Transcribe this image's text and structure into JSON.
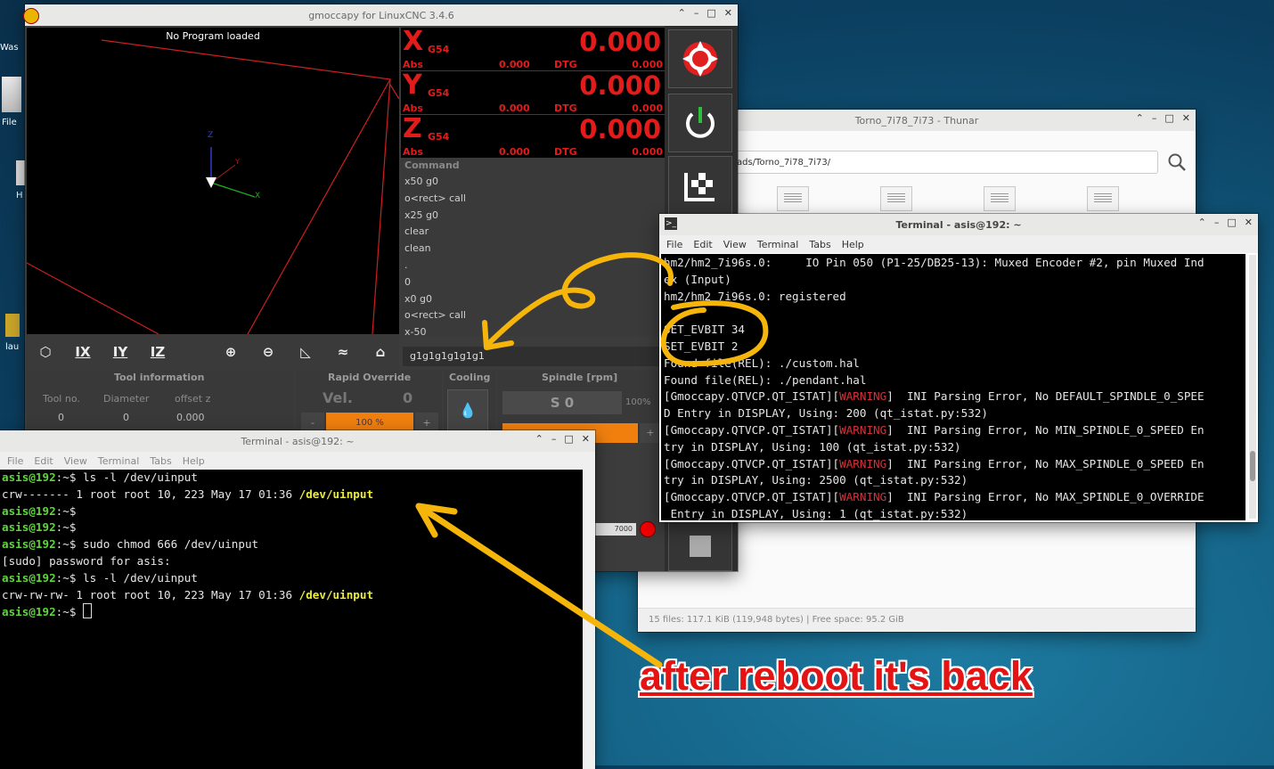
{
  "desktop": {
    "icons": [
      {
        "label": "Was"
      },
      {
        "label": "File"
      },
      {
        "label": "H"
      },
      {
        "label": "lau"
      }
    ]
  },
  "gmoccapy": {
    "title": "gmoccapy for LinuxCNC  3.4.6",
    "preview_title": "No Program loaded",
    "axes": [
      {
        "axis": "X",
        "offset": "G54",
        "value": "0.000",
        "abs_label": "Abs",
        "abs": "0.000",
        "dtg_label": "DTG",
        "dtg": "0.000"
      },
      {
        "axis": "Y",
        "offset": "G54",
        "value": "0.000",
        "abs_label": "Abs",
        "abs": "0.000",
        "dtg_label": "DTG",
        "dtg": "0.000"
      },
      {
        "axis": "Z",
        "offset": "G54",
        "value": "0.000",
        "abs_label": "Abs",
        "abs": "0.000",
        "dtg_label": "DTG",
        "dtg": "0.000"
      }
    ],
    "command_header": "Command",
    "commands": [
      "x50 g0",
      "o<rect> call",
      "x25 g0",
      "clear",
      "clean",
      ".",
      "0",
      "x0 g0",
      "o<rect> call",
      "x-50"
    ],
    "mdi_value": "g1g1g1g1g1g1",
    "view_buttons": [
      "IX",
      "IY",
      "IZ"
    ],
    "sections": {
      "tool_info": "Tool information",
      "rapid_override": "Rapid Override",
      "cooling": "Cooling",
      "spindle": "Spindle [rpm]"
    },
    "tool_table": {
      "headers": [
        "Tool no.",
        "Diameter",
        "offset z"
      ],
      "values": [
        "0",
        "0",
        "0.000"
      ]
    },
    "rapid": {
      "label": "Vel.",
      "value": "0",
      "percent": "100 %"
    },
    "spindle": {
      "speed": "S 0",
      "percent": "100%",
      "value": "7000"
    },
    "axis_labels": {
      "z": "Z",
      "x": "X",
      "y": "Y"
    }
  },
  "thunar": {
    "title": "Torno_7i78_7i73 - Thunar",
    "path": "ads/Torno_7i78_7i73/",
    "status": "15 files: 117.1 KiB (119,948 bytes)  |  Free space: 95.2 GiB"
  },
  "terminal_right": {
    "title": "Terminal - asis@192: ~",
    "menu": [
      "File",
      "Edit",
      "View",
      "Terminal",
      "Tabs",
      "Help"
    ],
    "lines": [
      {
        "parts": [
          {
            "t": "hm2/hm2_7i96s.0:     IO Pin 050 (P1-25/DB25-13): Muxed Encoder #2, pin Muxed Ind"
          }
        ]
      },
      {
        "parts": [
          {
            "t": "ex (Input)"
          }
        ]
      },
      {
        "parts": [
          {
            "t": "hm2/hm2_7i96s.0: registered"
          }
        ]
      },
      {
        "parts": [
          {
            "t": ""
          }
        ]
      },
      {
        "parts": [
          {
            "t": "SET_EVBIT 34"
          }
        ]
      },
      {
        "parts": [
          {
            "t": "SET_EVBIT 2"
          }
        ]
      },
      {
        "parts": [
          {
            "t": "Found file(REL): ./custom.hal"
          }
        ]
      },
      {
        "parts": [
          {
            "t": "Found file(REL): ./pendant.hal"
          }
        ]
      },
      {
        "parts": [
          {
            "t": "[Gmoccapy.QTVCP.QT_ISTAT]["
          },
          {
            "t": "WARNING",
            "c": "warnc"
          },
          {
            "t": "]  INI Parsing Error, No DEFAULT_SPINDLE_0_SPEE"
          }
        ]
      },
      {
        "parts": [
          {
            "t": "D Entry in DISPLAY, Using: 200 (qt_istat.py:532)"
          }
        ]
      },
      {
        "parts": [
          {
            "t": "[Gmoccapy.QTVCP.QT_ISTAT]["
          },
          {
            "t": "WARNING",
            "c": "warnc"
          },
          {
            "t": "]  INI Parsing Error, No MIN_SPINDLE_0_SPEED En"
          }
        ]
      },
      {
        "parts": [
          {
            "t": "try in DISPLAY, Using: 100 (qt_istat.py:532)"
          }
        ]
      },
      {
        "parts": [
          {
            "t": "[Gmoccapy.QTVCP.QT_ISTAT]["
          },
          {
            "t": "WARNING",
            "c": "warnc"
          },
          {
            "t": "]  INI Parsing Error, No MAX_SPINDLE_0_SPEED En"
          }
        ]
      },
      {
        "parts": [
          {
            "t": "try in DISPLAY, Using: 2500 (qt_istat.py:532)"
          }
        ]
      },
      {
        "parts": [
          {
            "t": "[Gmoccapy.QTVCP.QT_ISTAT]["
          },
          {
            "t": "WARNING",
            "c": "warnc"
          },
          {
            "t": "]  INI Parsing Error, No MAX_SPINDLE_0_OVERRIDE"
          }
        ]
      },
      {
        "parts": [
          {
            "t": " Entry in DISPLAY, Using: 1 (qt_istat.py:532)"
          }
        ]
      }
    ]
  },
  "terminal_left": {
    "title": "Terminal - asis@192: ~",
    "menu": [
      "File",
      "Edit",
      "View",
      "Terminal",
      "Tabs",
      "Help"
    ],
    "lines": [
      {
        "parts": [
          {
            "t": "asis@192",
            "c": "g"
          },
          {
            "t": ":~$ ls -l /dev/uinput"
          }
        ]
      },
      {
        "parts": [
          {
            "t": "crw------- 1 root root 10, 223 May 17 01:36 "
          },
          {
            "t": "/dev/uinput",
            "c": "y"
          }
        ]
      },
      {
        "parts": [
          {
            "t": "asis@192",
            "c": "g"
          },
          {
            "t": ":~$"
          }
        ]
      },
      {
        "parts": [
          {
            "t": "asis@192",
            "c": "g"
          },
          {
            "t": ":~$"
          }
        ]
      },
      {
        "parts": [
          {
            "t": "asis@192",
            "c": "g"
          },
          {
            "t": ":~$ sudo chmod 666 /dev/uinput"
          }
        ]
      },
      {
        "parts": [
          {
            "t": "[sudo] password for asis:"
          }
        ]
      },
      {
        "parts": [
          {
            "t": "asis@192",
            "c": "g"
          },
          {
            "t": ":~$ ls -l /dev/uinput"
          }
        ]
      },
      {
        "parts": [
          {
            "t": "crw-rw-rw- 1 root root 10, 223 May 17 01:36 "
          },
          {
            "t": "/dev/uinput",
            "c": "y"
          }
        ]
      },
      {
        "parts": [
          {
            "t": "asis@192",
            "c": "g"
          },
          {
            "t": ":~$ "
          }
        ],
        "cursor": true
      }
    ]
  },
  "annotation": {
    "text": "after reboot it's back",
    "color": "#e51414",
    "marker_color": "#f5b50a"
  }
}
